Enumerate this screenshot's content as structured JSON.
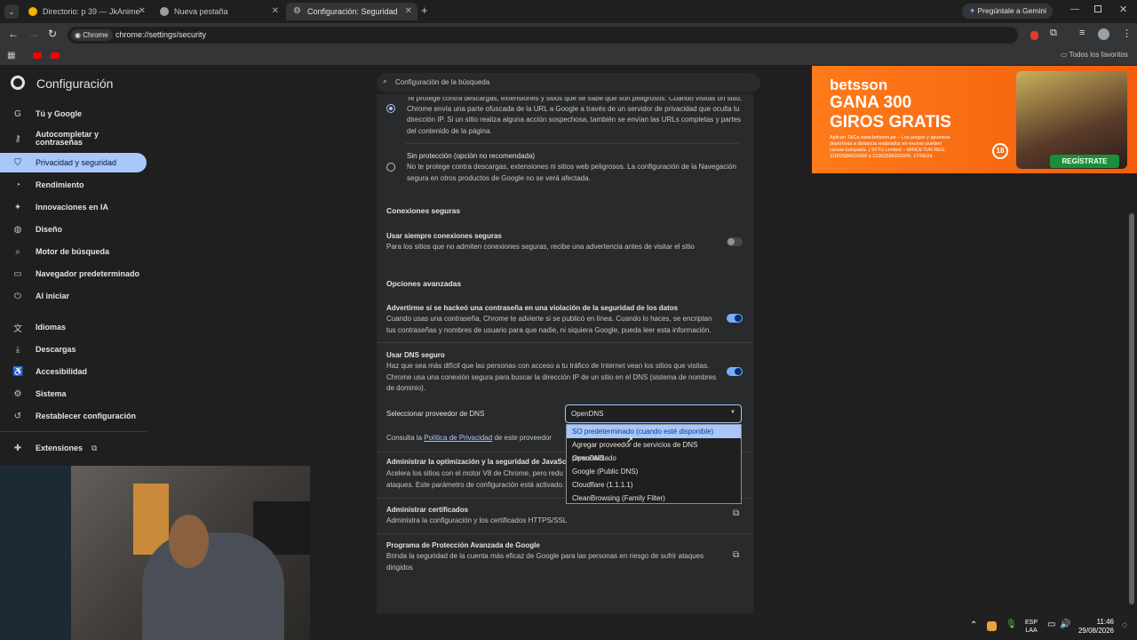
{
  "tabs": [
    {
      "title": "Directorio: p 39 — JkAnime",
      "color": "#f4b400"
    },
    {
      "title": "Nueva pestaña",
      "color": "#9aa0a6"
    },
    {
      "title": "Configuración: Seguridad",
      "color": "#9aa0a6"
    }
  ],
  "gemini_button": "Pregúntale a Gemini",
  "omnibox": {
    "chip": "Chrome",
    "url": "chrome://settings/security"
  },
  "bookmarks": {
    "all_label": "Todos los favoritos"
  },
  "settings_title": "Configuración",
  "search_placeholder": "Configuración de la búsqueda",
  "nav": [
    {
      "label": "Tú y Google",
      "icon": "google-icon"
    },
    {
      "label": "Autocompletar y contraseñas",
      "icon": "key-icon"
    },
    {
      "label": "Privacidad y seguridad",
      "icon": "shield-icon"
    },
    {
      "label": "Rendimiento",
      "icon": "speedometer-icon"
    },
    {
      "label": "Innovaciones en IA",
      "icon": "sparkle-icon"
    },
    {
      "label": "Diseño",
      "icon": "palette-icon"
    },
    {
      "label": "Motor de búsqueda",
      "icon": "search-icon"
    },
    {
      "label": "Navegador predeterminado",
      "icon": "browser-icon"
    },
    {
      "label": "Al iniciar",
      "icon": "power-icon"
    },
    {
      "label": "Idiomas",
      "icon": "translate-icon"
    },
    {
      "label": "Descargas",
      "icon": "download-icon"
    },
    {
      "label": "Accesibilidad",
      "icon": "accessibility-icon"
    },
    {
      "label": "Sistema",
      "icon": "wrench-icon"
    },
    {
      "label": "Restablecer configuración",
      "icon": "reset-icon"
    },
    {
      "label": "Extensiones",
      "icon": "puzzle-icon"
    }
  ],
  "content": {
    "standard_desc_line0": "Te protege contra descargas, extensiones y sitios que se sabe que son peligrosos. Cuando visitas un sitio,",
    "standard_desc_line1": "Chrome envía una parte ofuscada de la URL a Google a través de un servidor de privacidad que oculta tu",
    "standard_desc_line2": "dirección IP. Si un sitio realiza alguna acción sospechosa, también se envían las URLs completas y partes",
    "standard_desc_line3": "del contenido de la página.",
    "noprot_title": "Sin protección (opción no recomendada)",
    "noprot_line1": "No te protege contra descargas, extensiones ni sitios web peligrosos. La configuración de la Navegación",
    "noprot_line2": "segura en otros productos de Google no se verá afectada.",
    "secure_conn_heading": "Conexiones seguras",
    "https_title": "Usar siempre conexiones seguras",
    "https_desc": "Para los sitios que no admiten conexiones seguras, recibe una advertencia antes de visitar el sitio",
    "advanced_heading": "Opciones avanzadas",
    "pw_title": "Advertirme si se hackeó una contraseña en una violación de la seguridad de los datos",
    "pw_line1": "Cuando usas una contraseña, Chrome te advierte si se publicó en línea. Cuando lo haces, se encriptan",
    "pw_line2": "tus contraseñas y nombres de usuario para que nadie, ni siquiera Google, pueda leer esta información.",
    "dns_title": "Usar DNS seguro",
    "dns_line1": "Haz que sea más difícil que las personas con acceso a tu tráfico de Internet vean los sitios que visitas.",
    "dns_line2": "Chrome usa una conexión segura para buscar la dirección IP de un sitio en el DNS (sistema de nombres",
    "dns_line3": "de dominio).",
    "dns_provider_label": "Seleccionar proveedor de DNS",
    "dns_selected": "OpenDNS",
    "dns_options": [
      "SO predeterminado (cuando esté disponible)",
      "Agregar proveedor de servicios de DNS personalizado",
      "OpenDNS",
      "Google (Public DNS)",
      "Cloudflare (1.1.1.1)",
      "CleanBrowsing (Family Filter)"
    ],
    "policy_prefix": "Consulta la",
    "policy_link": "Política de Privacidad",
    "policy_suffix": "de este proveedor",
    "js_title": "Administrar la optimización y la seguridad de JavaScript",
    "js_line1": "Acelera los sitios con el motor V8 de Chrome, pero redu",
    "js_line2": "ataques. Este parámetro de configuración está activado.",
    "cert_title": "Administrar certificados",
    "cert_desc": "Administra la configuración y los certificados HTTPS/SSL",
    "apg_title": "Programa de Protección Avanzada de Google",
    "apg_line1": "Brinda la seguridad de la cuenta más eficaz de Google para las personas en riesgo de sufrir ataques",
    "apg_line2": "dirigidos"
  },
  "toggles": {
    "https": false,
    "password": true,
    "dns": true
  },
  "ad": {
    "brand": "betsson",
    "headline1": "GANA 300",
    "headline2": "GIROS GRATIS",
    "fineprint1": "Aplican T&Cs www.betsson.pe – Los juegos y apuestas",
    "fineprint2": "deportivas a distancia realizados en exceso pueden",
    "fineprint3": "causar ludopatía. | SFTG Limited – MINCETUR REG.",
    "fineprint4": "11002586010000 y 21002586020000, 17/06/24.",
    "age": "18",
    "cta": "REGÍSTRATE",
    "bg": "#f26a12"
  },
  "taskbar": {
    "lang1": "ESP",
    "lang2": "LAA",
    "time": "11:46",
    "date": "29/08/2026"
  }
}
